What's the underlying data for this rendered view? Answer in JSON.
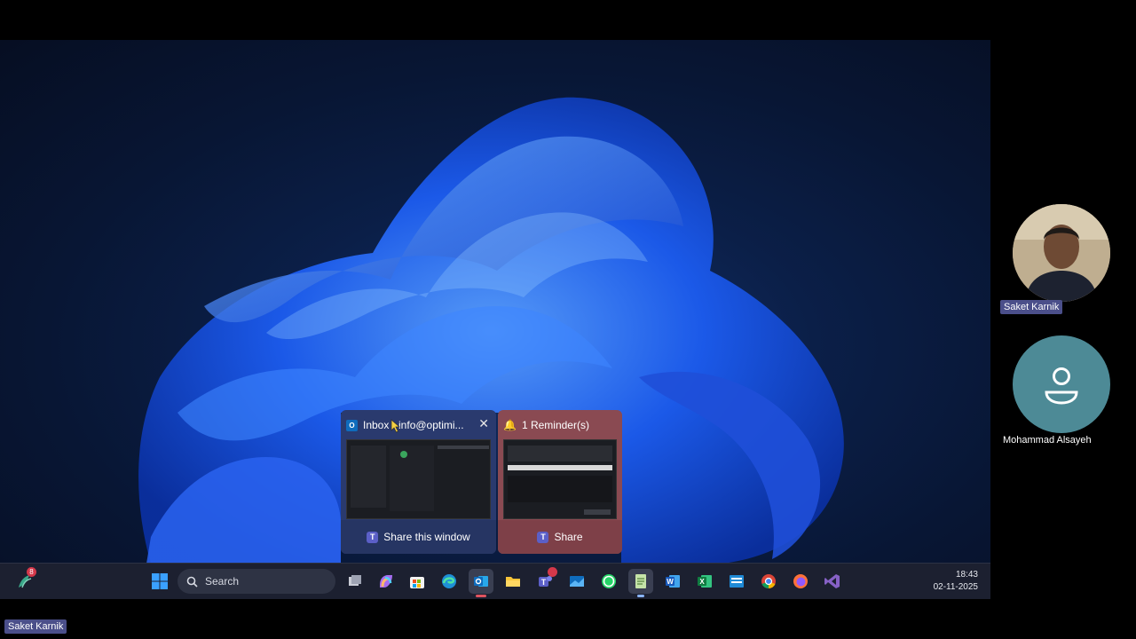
{
  "taskbar": {
    "search_label": "Search",
    "time": "18:43",
    "date": "02-11-2025",
    "widget_badge": "8",
    "icons": [
      "windows-start-icon",
      "task-view-icon",
      "copilot-icon",
      "store-icon",
      "edge-icon",
      "outlook-icon",
      "file-explorer-icon",
      "teams-icon",
      "mail-icon",
      "whatsapp-icon",
      "notepad-icon",
      "word-icon",
      "excel-icon",
      "app-icon",
      "chrome-icon",
      "firefox-icon",
      "visual-studio-icon"
    ]
  },
  "previews": {
    "outlook": {
      "title": "Inbox - info@optimi...",
      "share_label": "Share this window"
    },
    "reminder": {
      "title": "1 Reminder(s)",
      "share_label": "Share"
    }
  },
  "participants": {
    "presenter": "Saket Karnik",
    "attendee": "Mohammad Alsayeh",
    "self_label": "Saket Karnik"
  },
  "colors": {
    "accent": "#2f6bff",
    "teams": "#5b5fc7",
    "avatar_bg": "#4d8a96"
  }
}
